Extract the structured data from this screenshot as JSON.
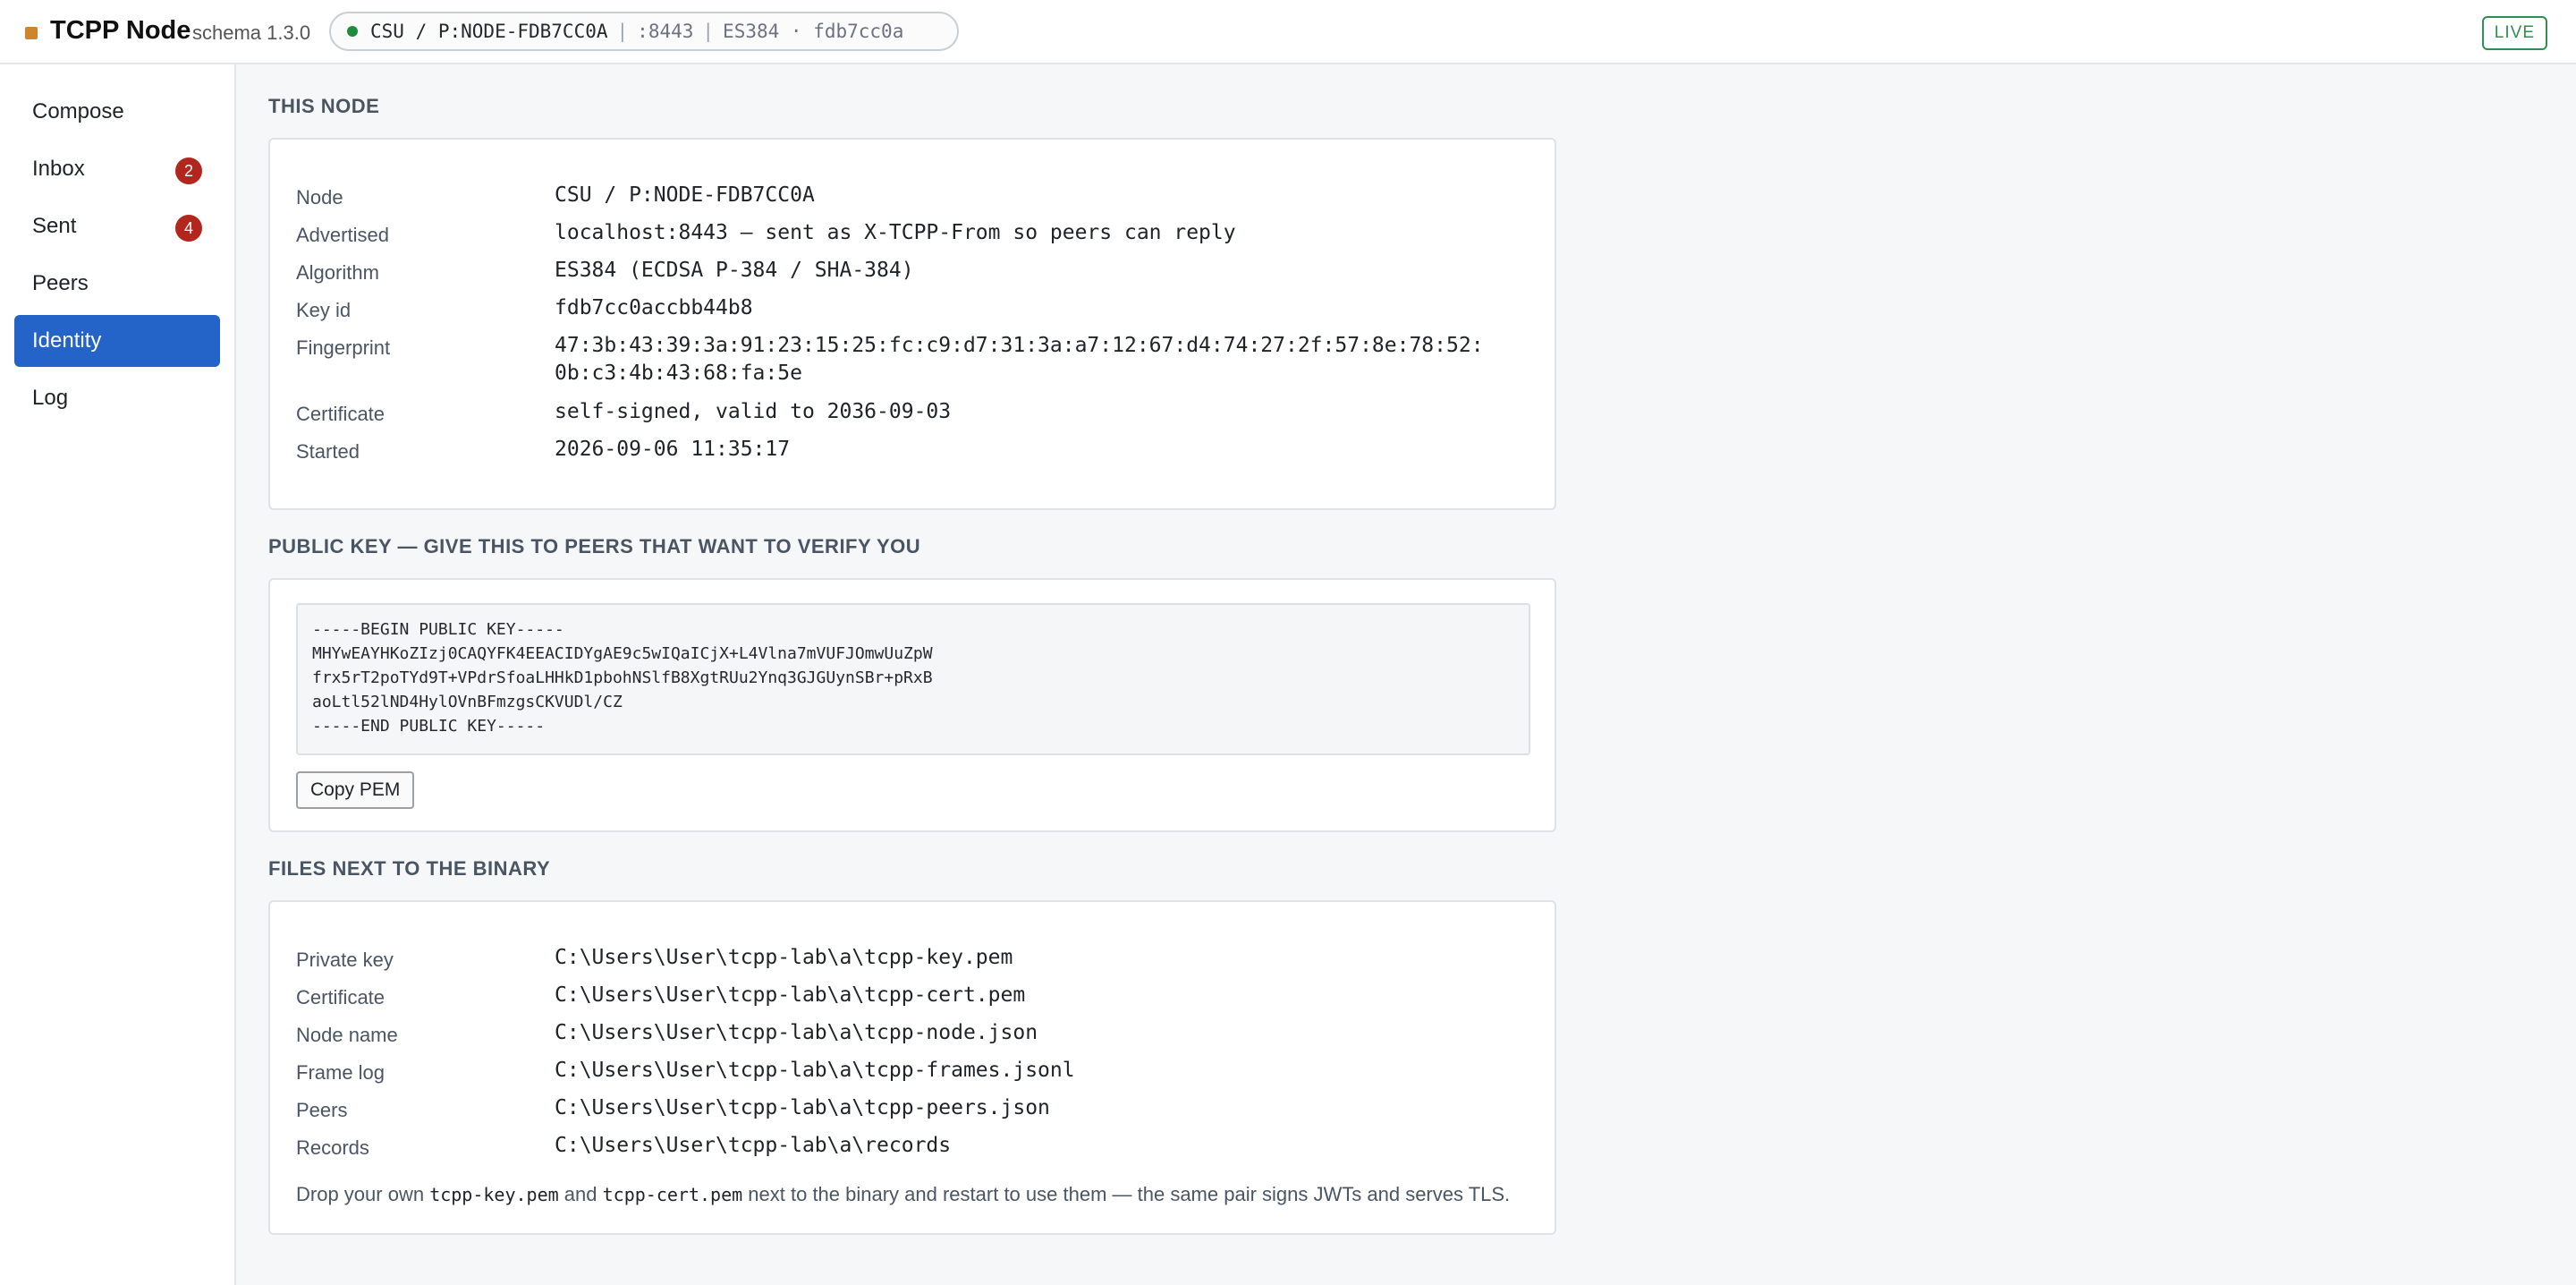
{
  "app": {
    "title": "TCPP Node",
    "schema": "schema 1.3.0",
    "node_chip": {
      "node": "CSU / P:NODE-FDB7CC0A",
      "port": ":8443",
      "algo_key": "ES384 · fdb7cc0a"
    },
    "status": "LIVE"
  },
  "sidebar": {
    "items": [
      {
        "label": "Compose",
        "badge": null
      },
      {
        "label": "Inbox",
        "badge": "2"
      },
      {
        "label": "Sent",
        "badge": "4"
      },
      {
        "label": "Peers",
        "badge": null
      },
      {
        "label": "Identity",
        "badge": null,
        "active": true
      },
      {
        "label": "Log",
        "badge": null
      }
    ]
  },
  "this_node": {
    "title": "THIS NODE",
    "rows": [
      {
        "label": "Node",
        "value": "CSU / P:NODE-FDB7CC0A"
      },
      {
        "label": "Advertised",
        "value": "localhost:8443 — sent as X-TCPP-From so peers can reply"
      },
      {
        "label": "Algorithm",
        "value": "ES384 (ECDSA P-384 / SHA-384)"
      },
      {
        "label": "Key id",
        "value": "fdb7cc0accbb44b8"
      },
      {
        "label": "Fingerprint",
        "value": "47:3b:43:39:3a:91:23:15:25:fc:c9:d7:31:3a:a7:12:67:d4:74:27:2f:57:8e:78:52:\n0b:c3:4b:43:68:fa:5e"
      },
      {
        "label": "Certificate",
        "value": "self-signed, valid to 2036-09-03"
      },
      {
        "label": "Started",
        "value": "2026-09-06 11:35:17"
      }
    ]
  },
  "public_key": {
    "title": "PUBLIC KEY — GIVE THIS TO PEERS THAT WANT TO VERIFY YOU",
    "pem": "-----BEGIN PUBLIC KEY-----\nMHYwEAYHKoZIzj0CAQYFK4EEACIDYgAE9c5wIQaICjX+L4Vlna7mVUFJOmwUuZpW\nfrx5rT2poTYd9T+VPdrSfoaLHHkD1pbohNSlfB8XgtRUu2Ynq3GJGUynSBr+pRxB\naoLtl52lND4HylOVnBFmzgsCKVUDl/CZ\n-----END PUBLIC KEY-----",
    "copy_label": "Copy PEM"
  },
  "files": {
    "title": "FILES NEXT TO THE BINARY",
    "rows": [
      {
        "label": "Private key",
        "value": "C:\\Users\\User\\tcpp-lab\\a\\tcpp-key.pem"
      },
      {
        "label": "Certificate",
        "value": "C:\\Users\\User\\tcpp-lab\\a\\tcpp-cert.pem"
      },
      {
        "label": "Node name",
        "value": "C:\\Users\\User\\tcpp-lab\\a\\tcpp-node.json"
      },
      {
        "label": "Frame log",
        "value": "C:\\Users\\User\\tcpp-lab\\a\\tcpp-frames.jsonl"
      },
      {
        "label": "Peers",
        "value": "C:\\Users\\User\\tcpp-lab\\a\\tcpp-peers.json"
      },
      {
        "label": "Records",
        "value": "C:\\Users\\User\\tcpp-lab\\a\\records"
      }
    ],
    "hint": {
      "prefix": "Drop your own ",
      "file1": "tcpp-key.pem",
      "mid": " and ",
      "file2": "tcpp-cert.pem",
      "suffix": " next to the binary and restart to use them — the same pair signs JWTs and serves TLS."
    }
  }
}
